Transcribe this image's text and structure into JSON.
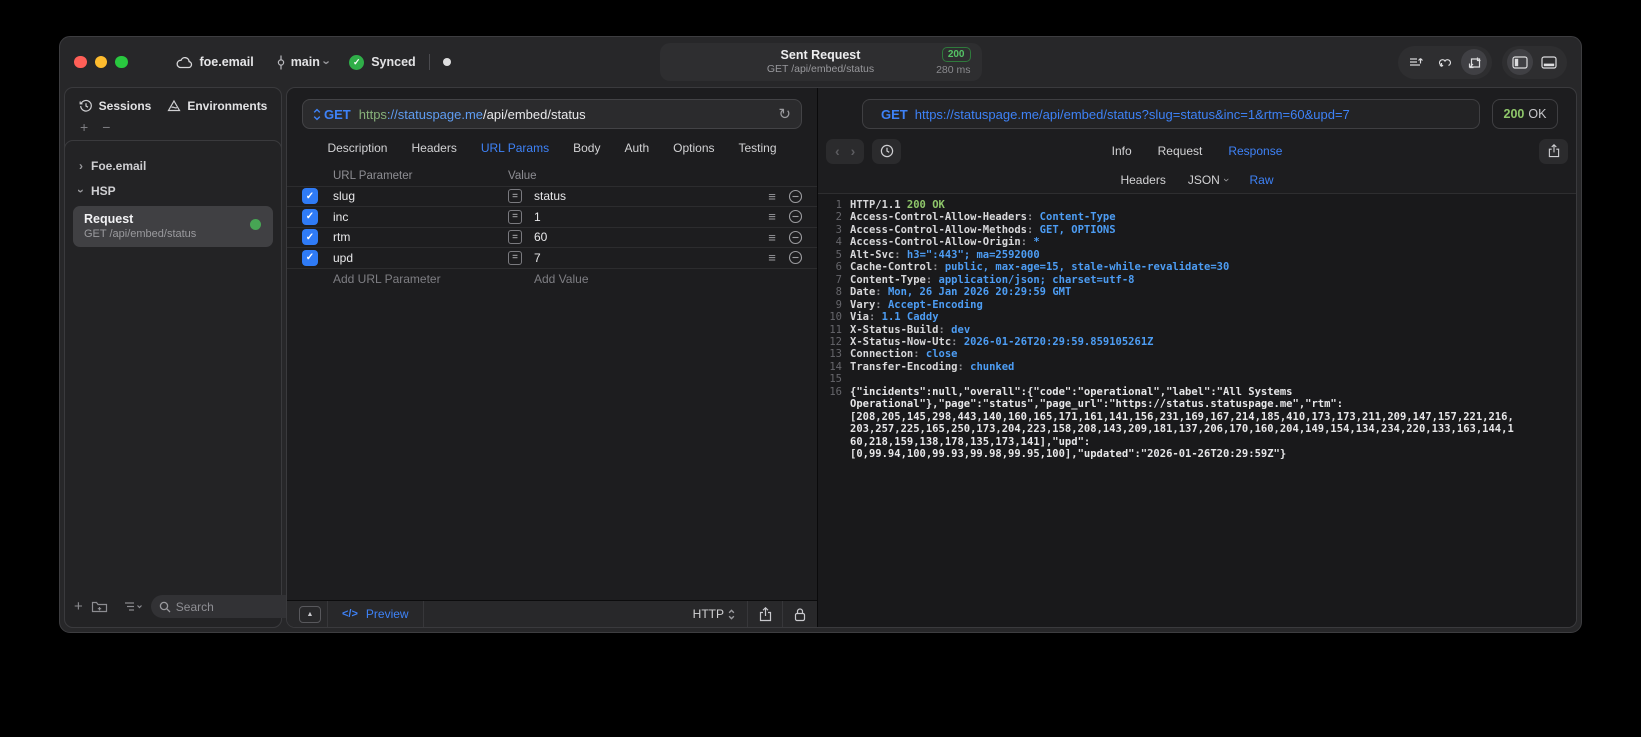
{
  "titlebar": {
    "project": "foe.email",
    "branch": "main",
    "sync_label": "Synced",
    "request_summary": {
      "title": "Sent Request",
      "status_code": "200",
      "method_path": "GET /api/embed/status",
      "duration": "280 ms"
    }
  },
  "sidebar": {
    "tabs": [
      {
        "label": "Sessions"
      },
      {
        "label": "Environments"
      }
    ],
    "groups": [
      {
        "label": "Foe.email"
      },
      {
        "label": "HSP"
      }
    ],
    "request_item": {
      "title": "Request",
      "subtitle": "GET /api/embed/status"
    },
    "search": {
      "placeholder": "Search"
    }
  },
  "request_editor": {
    "method": "GET",
    "url": {
      "scheme": "https",
      "host": "://statuspage.me",
      "path": "/api/embed/status"
    },
    "tabs": [
      "Description",
      "Headers",
      "URL Params",
      "Body",
      "Auth",
      "Options",
      "Testing"
    ],
    "active_tab": "URL Params",
    "params": {
      "columns": {
        "name": "URL Parameter",
        "value": "Value"
      },
      "rows": [
        {
          "name": "slug",
          "value": "status",
          "checked": true
        },
        {
          "name": "inc",
          "value": "1",
          "checked": true
        },
        {
          "name": "rtm",
          "value": "60",
          "checked": true
        },
        {
          "name": "upd",
          "value": "7",
          "checked": true
        }
      ],
      "add_name_placeholder": "Add URL Parameter",
      "add_value_placeholder": "Add Value"
    },
    "footer": {
      "code_glyph": "</>",
      "preview_label": "Preview",
      "protocol_selector": "HTTP"
    }
  },
  "response_viewer": {
    "request_line": {
      "method": "GET",
      "url": "https://statuspage.me/api/embed/status?slug=status&inc=1&rtm=60&upd=7"
    },
    "status": {
      "code": "200",
      "text": "OK"
    },
    "tabs": [
      "Info",
      "Request",
      "Response"
    ],
    "active_tab": "Response",
    "subtabs": [
      "Headers",
      "JSON",
      "Raw"
    ],
    "active_subtab": "Raw",
    "sep": ": ",
    "status_line": {
      "ln": "1",
      "protocol": "HTTP/1.1 ",
      "status": "200 OK"
    },
    "headers": [
      {
        "ln": "2",
        "name": "Access-Control-Allow-Headers",
        "value": "Content-Type"
      },
      {
        "ln": "3",
        "name": "Access-Control-Allow-Methods",
        "value": "GET, OPTIONS"
      },
      {
        "ln": "4",
        "name": "Access-Control-Allow-Origin",
        "value": "*"
      },
      {
        "ln": "5",
        "name": "Alt-Svc",
        "value": "h3=\":443\"; ma=2592000"
      },
      {
        "ln": "6",
        "name": "Cache-Control",
        "value": "public, max-age=15, stale-while-revalidate=30"
      },
      {
        "ln": "7",
        "name": "Content-Type",
        "value": "application/json; charset=utf-8"
      },
      {
        "ln": "8",
        "name": "Date",
        "value": "Mon, 26 Jan 2026 20:29:59 GMT"
      },
      {
        "ln": "9",
        "name": "Vary",
        "value": "Accept-Encoding"
      },
      {
        "ln": "10",
        "name": "Via",
        "value": "1.1 Caddy"
      },
      {
        "ln": "11",
        "name": "X-Status-Build",
        "value": "dev"
      },
      {
        "ln": "12",
        "name": "X-Status-Now-Utc",
        "value": "2026-01-26T20:29:59.859105261Z"
      },
      {
        "ln": "13",
        "name": "Connection",
        "value": "close"
      },
      {
        "ln": "14",
        "name": "Transfer-Encoding",
        "value": "chunked"
      }
    ],
    "blank_ln": "15",
    "body": {
      "ln": "16",
      "lines": [
        "{\"incidents\":null,\"overall\":{\"code\":\"operational\",\"label\":\"All Systems",
        "Operational\"},\"page\":\"status\",\"page_url\":\"https://status.statuspage.me\",\"rtm\":",
        "[208,205,145,298,443,140,160,165,171,161,141,156,231,169,167,214,185,410,173,173,211,209,147,157,221,216,",
        "203,257,225,165,250,173,204,223,158,208,143,209,181,137,206,170,160,204,149,154,134,234,220,133,163,144,1",
        "60,218,159,138,178,135,173,141],\"upd\":",
        "[0,99.94,100,99.93,99.98,99.95,100],\"updated\":\"2026-01-26T20:29:59Z\"}"
      ]
    }
  },
  "icons": {
    "check": "✓",
    "plus": "+",
    "minus": "−",
    "equals": "=",
    "reorder": "≡",
    "expand": "▲",
    "refresh": "↻",
    "back": "‹",
    "forward": "›",
    "chevron": "›"
  },
  "colors": {
    "accent_blue": "#3e82f7",
    "value_blue": "#4d9df4",
    "success_green": "#2fae48",
    "status_green": "#8fc76a",
    "traffic_red": "#ff5f57",
    "traffic_yellow": "#febc2e",
    "traffic_green": "#29c83f"
  }
}
